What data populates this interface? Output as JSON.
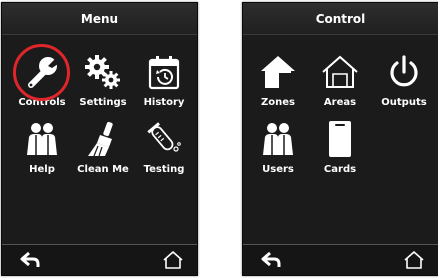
{
  "menu_screen": {
    "title": "Menu",
    "items": [
      {
        "label": "Controls",
        "icon": "wrench-icon",
        "highlighted": true
      },
      {
        "label": "Settings",
        "icon": "gears-icon"
      },
      {
        "label": "History",
        "icon": "calendar-history-icon"
      },
      {
        "label": "Help",
        "icon": "people-help-icon"
      },
      {
        "label": "Clean Me",
        "icon": "brush-icon"
      },
      {
        "label": "Testing",
        "icon": "test-tube-icon"
      }
    ],
    "back_icon": "back-arrow-icon",
    "home_icon": "home-outline-icon"
  },
  "control_screen": {
    "title": "Control",
    "items": [
      {
        "label": "Zones",
        "icon": "zones-house-icon"
      },
      {
        "label": "Areas",
        "icon": "areas-house-outline-icon"
      },
      {
        "label": "Outputs",
        "icon": "power-icon"
      },
      {
        "label": "Users",
        "icon": "users-icon"
      },
      {
        "label": "Cards",
        "icon": "card-icon"
      }
    ],
    "back_icon": "back-arrow-icon",
    "home_icon": "home-outline-icon"
  },
  "colors": {
    "screen_bg": "#1b1b1b",
    "highlight_ring": "#e0262a",
    "text": "#ffffff"
  }
}
